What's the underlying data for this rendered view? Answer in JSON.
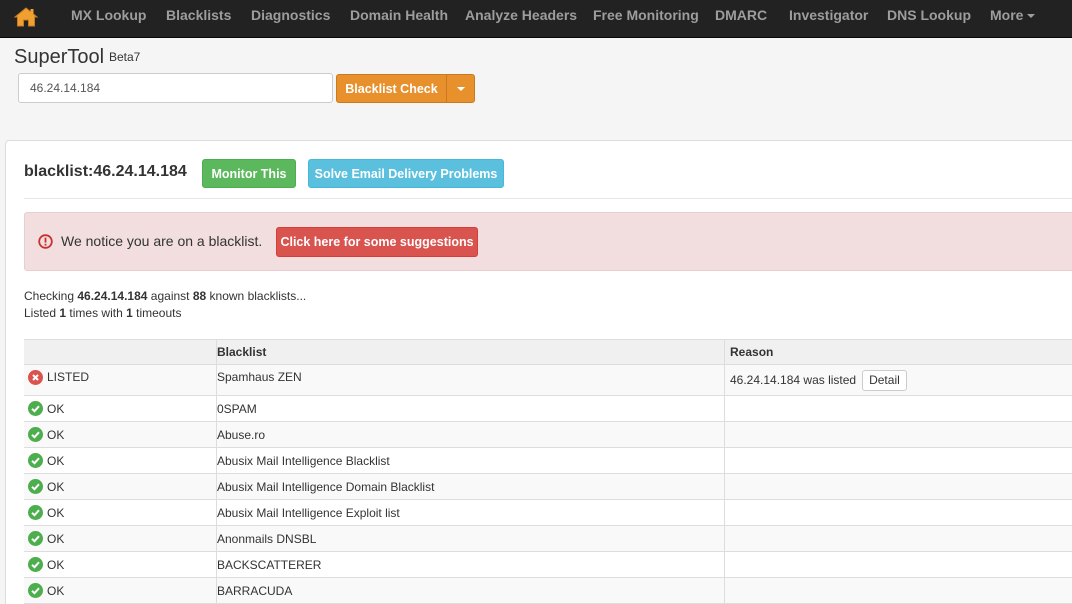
{
  "nav": {
    "items": [
      "MX Lookup",
      "Blacklists",
      "Diagnostics",
      "Domain Health",
      "Analyze Headers",
      "Free Monitoring",
      "DMARC",
      "Investigator",
      "DNS Lookup"
    ],
    "more": "More"
  },
  "supertool": {
    "title": "SuperTool",
    "beta": "Beta7",
    "input_value": "46.24.14.184",
    "check_button": "Blacklist Check"
  },
  "result": {
    "heading": "blacklist:46.24.14.184",
    "monitor_button": "Monitor This",
    "solve_button": "Solve Email Delivery Problems"
  },
  "alert": {
    "text": "We notice you are on a blacklist.",
    "button": "Click here for some suggestions"
  },
  "summary": {
    "checking": "Checking",
    "ip": "46.24.14.184",
    "against": "against",
    "count": "88",
    "known": "known blacklists...",
    "listed": "Listed",
    "listed_count": "1",
    "times_with": "times with",
    "timeouts_count": "1",
    "timeouts": "timeouts"
  },
  "table": {
    "headers": [
      "",
      "Blacklist",
      "Reason"
    ],
    "detail_label": "Detail",
    "rows": [
      {
        "status": "LISTED",
        "blacklist": "Spamhaus ZEN",
        "reason": "46.24.14.184 was listed"
      },
      {
        "status": "OK",
        "blacklist": "0SPAM",
        "reason": ""
      },
      {
        "status": "OK",
        "blacklist": "Abuse.ro",
        "reason": ""
      },
      {
        "status": "OK",
        "blacklist": "Abusix Mail Intelligence Blacklist",
        "reason": ""
      },
      {
        "status": "OK",
        "blacklist": "Abusix Mail Intelligence Domain Blacklist",
        "reason": ""
      },
      {
        "status": "OK",
        "blacklist": "Abusix Mail Intelligence Exploit list",
        "reason": ""
      },
      {
        "status": "OK",
        "blacklist": "Anonmails DNSBL",
        "reason": ""
      },
      {
        "status": "OK",
        "blacklist": "BACKSCATTERER",
        "reason": ""
      },
      {
        "status": "OK",
        "blacklist": "BARRACUDA",
        "reason": ""
      }
    ]
  },
  "colors": {
    "navbar": "#222222",
    "orange": "#e8912c",
    "green": "#5cb85c",
    "blue": "#5bc0de",
    "red": "#d9534f",
    "ok_icon": "#5cb85c",
    "listed_icon": "#d9534f"
  }
}
